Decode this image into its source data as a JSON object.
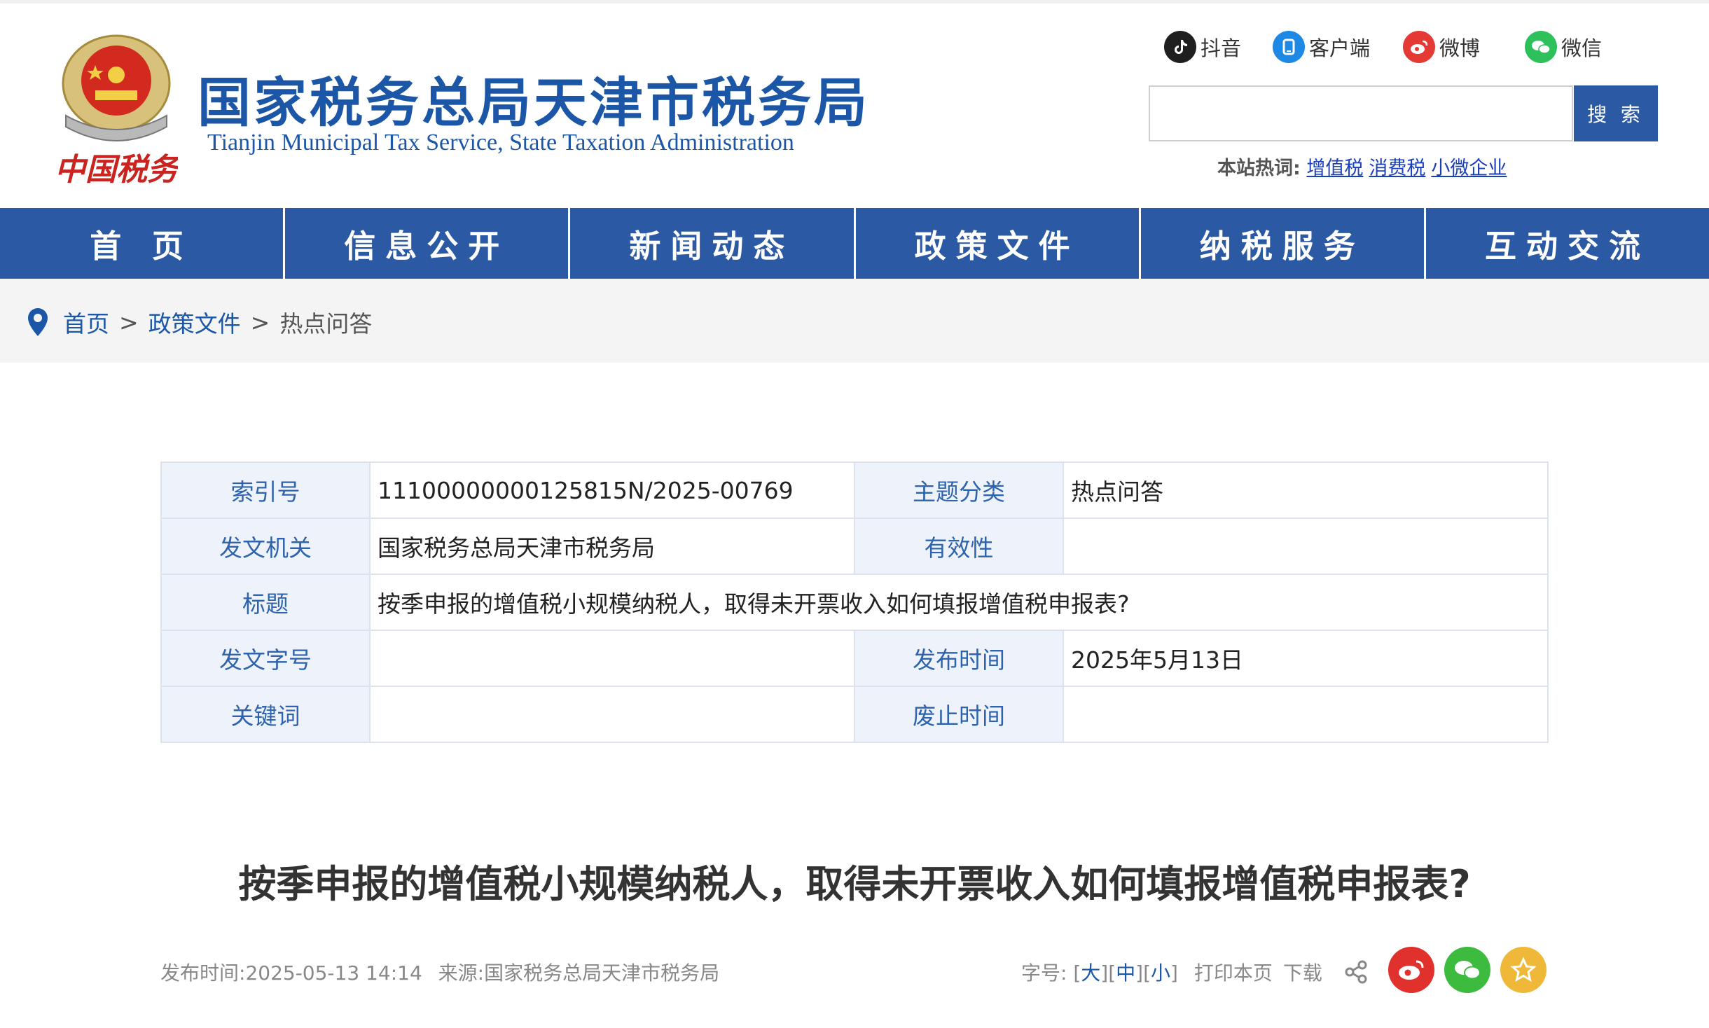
{
  "header": {
    "title_cn": "国家税务总局天津市税务局",
    "title_en": "Tianjin Municipal Tax Service, State Taxation Administration",
    "emblem_text": "中国税务",
    "social": [
      {
        "label": "抖音",
        "icon": "douyin-icon",
        "color": "#1f1f1f"
      },
      {
        "label": "客户端",
        "icon": "client-app-icon",
        "color": "#1e88e5"
      },
      {
        "label": "微博",
        "icon": "weibo-icon",
        "color": "#e53935"
      },
      {
        "label": "微信",
        "icon": "wechat-icon",
        "color": "#2ec05a"
      }
    ],
    "search": {
      "button_label": "搜 索",
      "placeholder": ""
    },
    "hot_label": "本站热词:",
    "hot_words": [
      "增值税",
      "消费税",
      "小微企业"
    ]
  },
  "nav": {
    "items": [
      "首 页",
      "信息公开",
      "新闻动态",
      "政策文件",
      "纳税服务",
      "互动交流"
    ]
  },
  "breadcrumb": {
    "home": "首页",
    "section": "政策文件",
    "current": "热点问答",
    "separator": ">"
  },
  "meta": {
    "index_label": "索引号",
    "index_value": "11100000000125815N/2025-00769",
    "category_label": "主题分类",
    "category_value": "热点问答",
    "issuer_label": "发文机关",
    "issuer_value": "国家税务总局天津市税务局",
    "validity_label": "有效性",
    "validity_value": "",
    "title_label": "标题",
    "title_value": "按季申报的增值税小规模纳税人，取得未开票收入如何填报增值税申报表?",
    "docno_label": "发文字号",
    "docno_value": "",
    "pubdate_label": "发布时间",
    "pubdate_value": "2025年5月13日",
    "keywords_label": "关键词",
    "keywords_value": "",
    "expire_label": "废止时间",
    "expire_value": ""
  },
  "article": {
    "title": "按季申报的增值税小规模纳税人，取得未开票收入如何填报增值税申报表?",
    "published_label": "发布时间:",
    "published_value": "2025-05-13 14:14",
    "source_label": "来源:",
    "source_value": "国家税务总局天津市税务局",
    "fontsize_label": "字号:",
    "font_large": "大",
    "font_medium": "中",
    "font_small": "小",
    "print_label": "打印本页",
    "download_label": "下载"
  },
  "colors": {
    "brand_blue": "#2b59a4",
    "link_blue": "#1b57a6",
    "weibo": "#e0312d",
    "wechat": "#3dbb3f",
    "favorite": "#f0b838"
  }
}
